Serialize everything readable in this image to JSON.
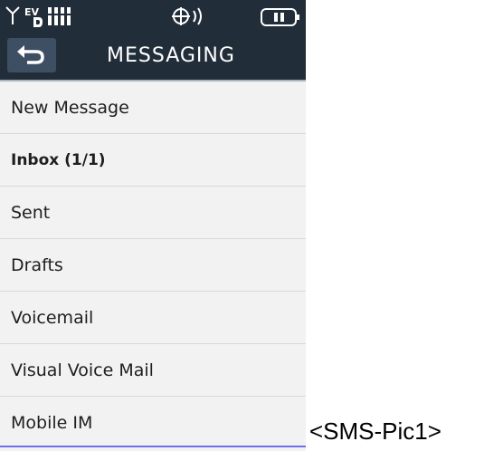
{
  "status_bar": {
    "network_label": "EV",
    "icons": [
      "signal-icon",
      "ev-network-icon",
      "signal-bars-icon",
      "volume-icon",
      "battery-icon"
    ]
  },
  "header": {
    "title": "MESSAGING",
    "back_icon": "back-arrow-icon"
  },
  "menu": {
    "items": [
      {
        "label": "New Message",
        "bold": false
      },
      {
        "label": "Inbox (1/1)",
        "bold": true
      },
      {
        "label": "Sent",
        "bold": false
      },
      {
        "label": "Drafts",
        "bold": false
      },
      {
        "label": "Voicemail",
        "bold": false
      },
      {
        "label": "Visual Voice Mail",
        "bold": false
      },
      {
        "label": "Mobile IM",
        "bold": false
      }
    ]
  },
  "caption": "<SMS-Pic1>",
  "colors": {
    "header_bg": "#222d3a",
    "list_bg": "#f2f2f2",
    "back_button_bg": "#3e4e63",
    "accent_line": "#6f6ff0"
  }
}
